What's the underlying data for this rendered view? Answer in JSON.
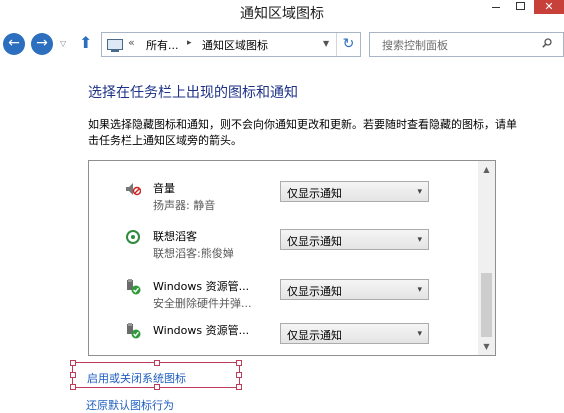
{
  "window": {
    "title": "通知区域图标",
    "close_label": "✕"
  },
  "nav": {
    "back_glyph": "←",
    "forward_glyph": "→",
    "recent_glyph": "▽",
    "up_glyph": "⬆"
  },
  "address": {
    "prefix": "«",
    "segments": [
      "所有...",
      "通知区域图标"
    ],
    "separator": "▸",
    "dropdown_glyph": "▼",
    "refresh_glyph": "↻"
  },
  "search": {
    "placeholder": "搜索控制面板"
  },
  "heading": "选择在任务栏上出现的图标和通知",
  "description": "如果选择隐藏图标和通知，则不会向你通知更改和更新。若要随时查看隐藏的图标，请单击任务栏上通知区域旁的箭头。",
  "items": [
    {
      "name": "音量",
      "desc": "扬声器: 静音",
      "behavior": "仅显示通知",
      "icon": "speaker-muted-icon"
    },
    {
      "name": "联想滔客",
      "desc": "联想滔客:熊俊婵",
      "behavior": "仅显示通知",
      "icon": "lenovo-chat-icon"
    },
    {
      "name": "Windows 资源管...",
      "desc": "安全删除硬件并弹...",
      "behavior": "仅显示通知",
      "icon": "usb-check-icon"
    },
    {
      "name": "Windows 资源管...",
      "desc": "",
      "behavior": "仅显示通知",
      "icon": "usb-check-icon"
    }
  ],
  "scroll": {
    "up_glyph": "▲",
    "down_glyph": "▼"
  },
  "select_arrow": "▾",
  "links": {
    "system_icons": "启用或关闭系统图标",
    "restore_defaults": "还原默认图标行为"
  },
  "colors": {
    "heading": "#1e3287",
    "link": "#1e5ec1",
    "close_button": "#c7403a",
    "highlight_box": "#c03a5a"
  }
}
